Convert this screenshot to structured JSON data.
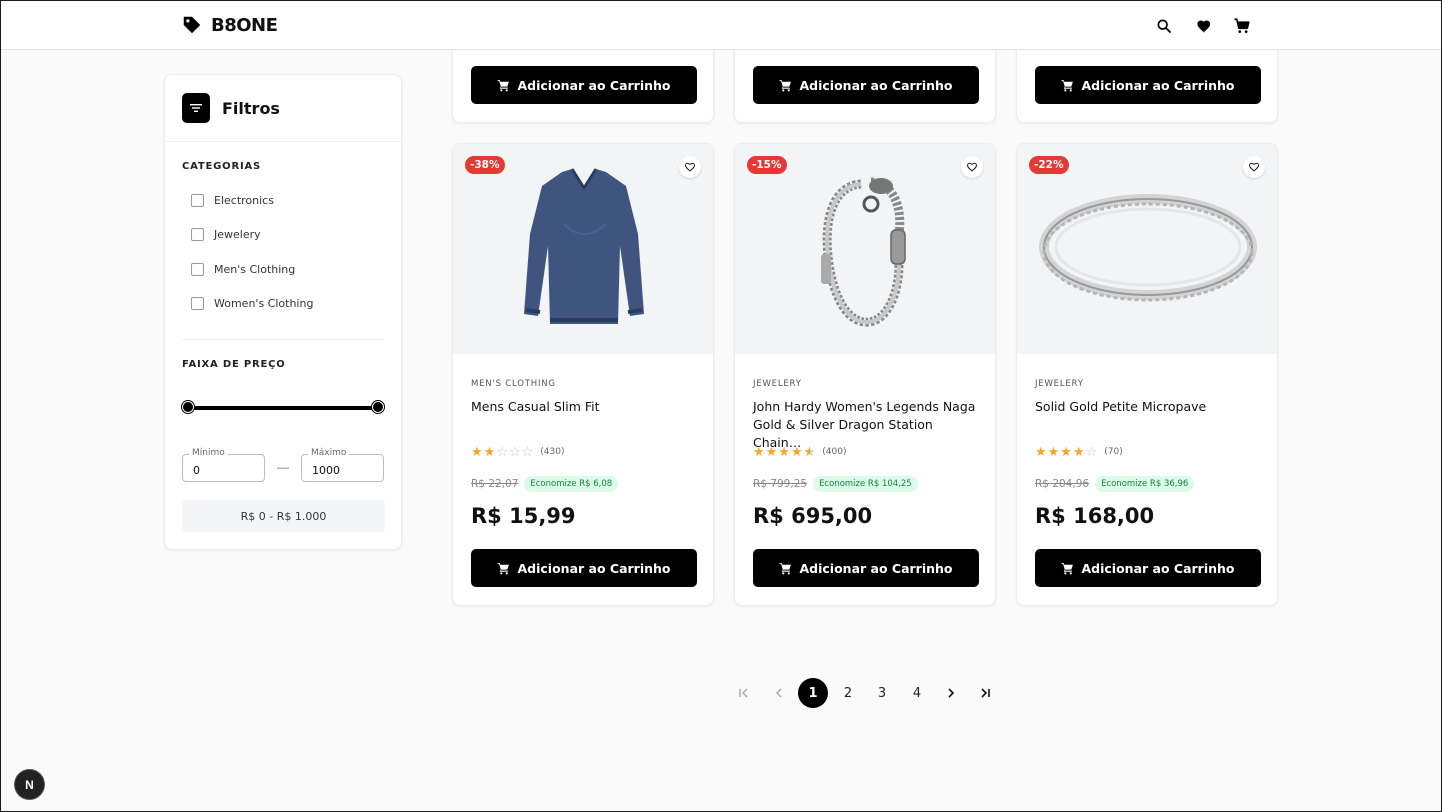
{
  "header": {
    "brand": "B8ONE",
    "icons": [
      "search-icon",
      "heart-icon",
      "cart-icon"
    ]
  },
  "sidebar": {
    "title": "Filtros",
    "categories_label": "CATEGORIAS",
    "categories": [
      "Electronics",
      "Jewelery",
      "Men's Clothing",
      "Women's Clothing"
    ],
    "price_label": "FAIXA DE PREÇO",
    "price_slider": {
      "min": 0,
      "max": 1000,
      "low": 0,
      "high": 1000
    },
    "min_label": "Mínimo",
    "min_value": "0",
    "max_label": "Máximo",
    "max_value": "1000",
    "range_text": "R$ 0 - R$ 1.000"
  },
  "cart_label": "Adicionar ao Carrinho",
  "products": [
    {
      "discount": "-38%",
      "category": "MEN'S CLOTHING",
      "name": "Mens Casual Slim Fit",
      "rating": 2,
      "reviews": "(430)",
      "old_price": "R$ 22,07",
      "savings": "Economize R$ 6,08",
      "price": "R$ 15,99"
    },
    {
      "discount": "-15%",
      "category": "JEWELERY",
      "name": "John Hardy Women's Legends Naga Gold & Silver Dragon Station Chain…",
      "rating": 4.5,
      "reviews": "(400)",
      "old_price": "R$ 799,25",
      "savings": "Economize R$ 104,25",
      "price": "R$ 695,00"
    },
    {
      "discount": "-22%",
      "category": "JEWELERY",
      "name": "Solid Gold Petite Micropave",
      "rating": 4,
      "reviews": "(70)",
      "old_price": "R$ 204,96",
      "savings": "Economize R$ 36,96",
      "price": "R$ 168,00"
    }
  ],
  "pagination": {
    "pages": [
      "1",
      "2",
      "3",
      "4"
    ],
    "current": "1"
  },
  "dev_badge": "N",
  "colors": {
    "primary": "#000000",
    "discount": "#e53935",
    "star": "#f5a623",
    "savings_bg": "#dcfce7",
    "savings_text": "#15803d"
  }
}
